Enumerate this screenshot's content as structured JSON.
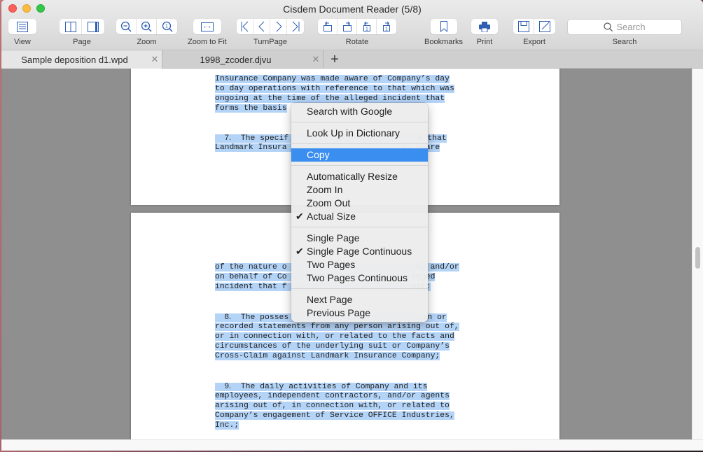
{
  "window": {
    "title": "Cisdem Document Reader (5/8)"
  },
  "toolbar": {
    "view_label": "View",
    "page_label": "Page",
    "zoom_label": "Zoom",
    "zoom_to_fit_label": "Zoom to Fit",
    "turnpage_label": "TurnPage",
    "rotate_label": "Rotate",
    "bookmarks_label": "Bookmarks",
    "print_label": "Print",
    "export_label": "Export",
    "search_label": "Search",
    "search_placeholder": "Search"
  },
  "tabs": [
    {
      "title": "Sample deposition d1.wpd",
      "active": true
    },
    {
      "title": "1998_zcoder.djvu",
      "active": false
    }
  ],
  "document": {
    "page1_lines": [
      "Insurance Company was made aware of Company’s day",
      "to day operations with reference to that which was",
      "ongoing at the time of the alleged incident that",
      "forms the basis"
    ],
    "para7_number": "7.",
    "para7_lines": [
      "  The specif                           s that",
      "Landmark Insura                        ly aware"
    ],
    "page2_lines": [
      "of the nature o                           by and/or",
      "on behalf of Co                          leged",
      "incident that f                          uit;"
    ],
    "para8_number": "8.",
    "para8_lines": [
      "  The posses                            en or",
      "recorded statements from any person arising out of,",
      "or in connection with, or related to the facts and",
      "circumstances of the underlying suit or Company’s",
      "Cross-Claim against Landmark Insurance Company;"
    ],
    "para9_number": "9.",
    "para9_lines": [
      "  The daily activities of Company and its",
      "employees, independent contractors, and/or agents",
      "arising out of, in connection with, or related to",
      "Company’s engagement of Service OFFICE Industries,",
      "Inc.;"
    ]
  },
  "context_menu": {
    "groups": [
      [
        {
          "label": "Search with Google"
        }
      ],
      [
        {
          "label": "Look Up in Dictionary"
        }
      ],
      [
        {
          "label": "Copy",
          "highlighted": true
        }
      ],
      [
        {
          "label": "Automatically Resize"
        },
        {
          "label": "Zoom In"
        },
        {
          "label": "Zoom Out"
        },
        {
          "label": "Actual Size",
          "checked": true
        }
      ],
      [
        {
          "label": "Single Page"
        },
        {
          "label": "Single Page Continuous",
          "checked": true
        },
        {
          "label": "Two Pages"
        },
        {
          "label": "Two Pages Continuous"
        }
      ],
      [
        {
          "label": "Next Page"
        },
        {
          "label": "Previous Page"
        }
      ]
    ],
    "check_glyph": "✔"
  },
  "colors": {
    "accent": "#3a8ef0",
    "icon_blue": "#2f5fb3",
    "selection": "#b3d3f7"
  }
}
